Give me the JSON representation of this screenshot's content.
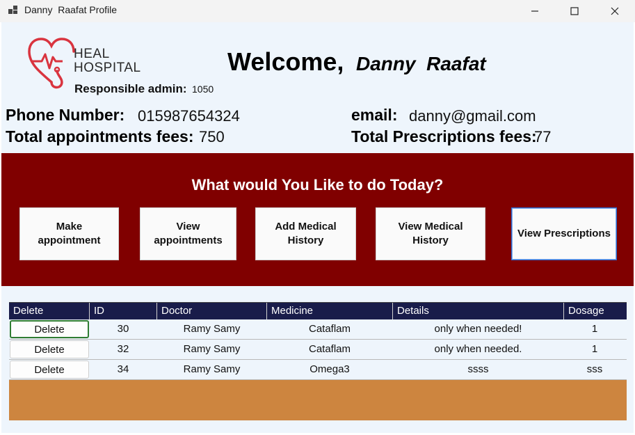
{
  "window": {
    "title": "Danny  Raafat Profile",
    "controls": [
      "minimize",
      "maximize",
      "close"
    ]
  },
  "brand": {
    "line1": "HEAL",
    "line2": "HOSPITAL",
    "logo_color": "#d9343f",
    "icon": "heart-stethoscope-icon"
  },
  "admin": {
    "label": "Responsible admin:",
    "value": "1050"
  },
  "welcome": {
    "prefix": "Welcome,",
    "name": "Danny  Raafat"
  },
  "info": {
    "phone_label": "Phone Number:",
    "phone_value": "015987654324",
    "email_label": "email:",
    "email_value": "danny@gmail.com",
    "appt_fees_label": "Total appointments fees:",
    "appt_fees_value": "750",
    "presc_fees_label": "Total Prescriptions fees:",
    "presc_fees_value": "77"
  },
  "actions": {
    "prompt": "What would You Like to do Today?",
    "banner_color": "#800000",
    "buttons": [
      "Make appointment",
      "View appointments",
      "Add Medical History",
      "View Medical History",
      "View Prescriptions"
    ]
  },
  "grid": {
    "headers": [
      "Delete",
      "ID",
      "Doctor",
      "Medicine",
      "Details",
      "Dosage"
    ],
    "header_color": "#191c4a",
    "empty_area_color": "#cd853f",
    "rows": [
      {
        "action": "Delete",
        "id": "30",
        "doctor": "Ramy Samy",
        "medicine": "Cataflam",
        "details": "only when needed!",
        "dosage": "1"
      },
      {
        "action": "Delete",
        "id": "32",
        "doctor": "Ramy Samy",
        "medicine": "Cataflam",
        "details": "only when needed.",
        "dosage": "1"
      },
      {
        "action": "Delete",
        "id": "34",
        "doctor": "Ramy Samy",
        "medicine": "Omega3",
        "details": "ssss",
        "dosage": "sss"
      }
    ]
  }
}
